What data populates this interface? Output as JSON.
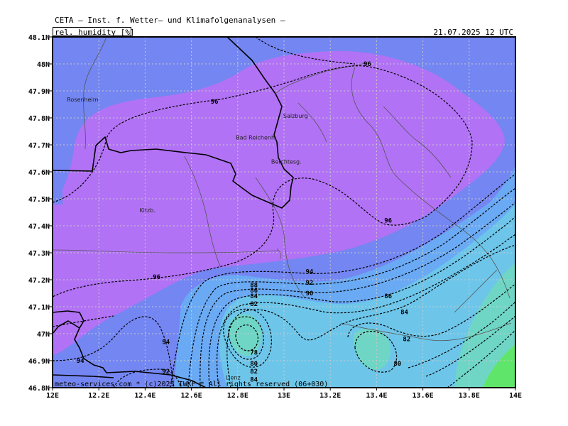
{
  "header": {
    "title": "CETA — Inst. f. Wetter— und Klimafolgenanalysen —",
    "parameter": "rel._humidity_[%]",
    "datetime": "21.07.2025 12 UTC"
  },
  "map": {
    "lon_range": [
      12,
      14
    ],
    "lat_range": [
      46.8,
      48.1
    ],
    "lat_ticks": [
      {
        "value": 48.1,
        "label": "48.1N"
      },
      {
        "value": 48.0,
        "label": "48N"
      },
      {
        "value": 47.9,
        "label": "47.9N"
      },
      {
        "value": 47.8,
        "label": "47.8N"
      },
      {
        "value": 47.7,
        "label": "47.7N"
      },
      {
        "value": 47.6,
        "label": "47.6N"
      },
      {
        "value": 47.5,
        "label": "47.5N"
      },
      {
        "value": 47.4,
        "label": "47.4N"
      },
      {
        "value": 47.3,
        "label": "47.3N"
      },
      {
        "value": 47.2,
        "label": "47.2N"
      },
      {
        "value": 47.1,
        "label": "47.1N"
      },
      {
        "value": 47.0,
        "label": "47N"
      },
      {
        "value": 46.9,
        "label": "46.9N"
      },
      {
        "value": 46.8,
        "label": "46.8N"
      }
    ],
    "lon_ticks": [
      {
        "value": 12.0,
        "label": "12E"
      },
      {
        "value": 12.2,
        "label": "12.2E"
      },
      {
        "value": 12.4,
        "label": "12.4E"
      },
      {
        "value": 12.6,
        "label": "12.6E"
      },
      {
        "value": 12.8,
        "label": "12.8E"
      },
      {
        "value": 13.0,
        "label": "13E"
      },
      {
        "value": 13.2,
        "label": "13.2E"
      },
      {
        "value": 13.4,
        "label": "13.4E"
      },
      {
        "value": 13.6,
        "label": "13.6E"
      },
      {
        "value": 13.8,
        "label": "13.8E"
      },
      {
        "value": 14.0,
        "label": "14E"
      }
    ],
    "grid": true,
    "colors": {
      "humidity_96_plus": "#b272f5",
      "humidity_92_96": "#7486f2",
      "humidity_88_92": "#6aaaf5",
      "humidity_84_88": "#6dc6ea",
      "humidity_80_84": "#6fd6c6",
      "humidity_low": "#5fe66a",
      "grid": "#c9c9c9",
      "border": "#000000",
      "river": "#555555",
      "contour": "#000000"
    },
    "cities": [
      {
        "name": "Rosenheim",
        "lon": 12.13,
        "lat": 47.86
      },
      {
        "name": "Salzburg",
        "lon": 13.05,
        "lat": 47.8
      },
      {
        "name": "Bad Reichenh.",
        "lon": 12.88,
        "lat": 47.72
      },
      {
        "name": "Berchtesg.",
        "lon": 13.01,
        "lat": 47.63
      },
      {
        "name": "Kitzb.",
        "lon": 12.41,
        "lat": 47.45
      },
      {
        "name": "Lienz",
        "lon": 12.78,
        "lat": 46.83
      }
    ],
    "contour_labels": [
      {
        "text": "96",
        "lon": 13.36,
        "lat": 48.0
      },
      {
        "text": "96",
        "lon": 12.7,
        "lat": 47.86
      },
      {
        "text": "96",
        "lon": 13.45,
        "lat": 47.42
      },
      {
        "text": "96",
        "lon": 12.45,
        "lat": 47.21
      },
      {
        "text": "94",
        "lon": 13.11,
        "lat": 47.23
      },
      {
        "text": "92",
        "lon": 13.11,
        "lat": 47.19
      },
      {
        "text": "90",
        "lon": 13.11,
        "lat": 47.15
      },
      {
        "text": "88",
        "lon": 12.87,
        "lat": 47.18
      },
      {
        "text": "86",
        "lon": 12.87,
        "lat": 47.16
      },
      {
        "text": "84",
        "lon": 12.87,
        "lat": 47.14
      },
      {
        "text": "82",
        "lon": 12.87,
        "lat": 47.11
      },
      {
        "text": "86",
        "lon": 13.45,
        "lat": 47.14
      },
      {
        "text": "84",
        "lon": 13.52,
        "lat": 47.08
      },
      {
        "text": "82",
        "lon": 13.53,
        "lat": 46.98
      },
      {
        "text": "80",
        "lon": 13.49,
        "lat": 46.89
      },
      {
        "text": "78",
        "lon": 12.87,
        "lat": 46.93
      },
      {
        "text": "80",
        "lon": 12.87,
        "lat": 46.89
      },
      {
        "text": "82",
        "lon": 12.87,
        "lat": 46.86
      },
      {
        "text": "84",
        "lon": 12.87,
        "lat": 46.83
      },
      {
        "text": "94",
        "lon": 12.49,
        "lat": 46.97
      },
      {
        "text": "94",
        "lon": 12.12,
        "lat": 46.9
      },
      {
        "text": "92",
        "lon": 12.49,
        "lat": 46.86
      }
    ]
  },
  "footer": {
    "copyright": "meteo-services.com * (c)2025 IWKF * All rights reserved (06+030)"
  }
}
